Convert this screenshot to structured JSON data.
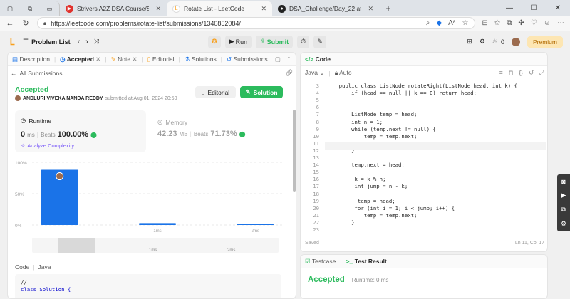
{
  "browser": {
    "tabs": [
      {
        "label": "Strivers A2Z DSA Course/Sheet",
        "fav_color": "#e0322d",
        "active": false
      },
      {
        "label": "Rotate List - LeetCode",
        "fav_color": "#f89f1b",
        "active": true
      },
      {
        "label": "DSA_Challenge/Day_22 at main",
        "fav_color": "#222222",
        "active": false
      }
    ],
    "new_tab": "+",
    "url": "https://leetcode.com/problems/rotate-list/submissions/1340852084/"
  },
  "header": {
    "problem_list": "Problem List",
    "run": "Run",
    "submit": "Submit",
    "streak_count": "0",
    "premium": "Premium"
  },
  "left_tabs": [
    "Description",
    "Accepted",
    "Note",
    "Editorial",
    "Solutions",
    "Submissions"
  ],
  "all_submissions": "All Submissions",
  "result": {
    "status": "Accepted",
    "user": "ANDLURI VIVEKA NANDA REDDY",
    "submitted": "submitted at Aug 01, 2024 20:50",
    "editorial_btn": "Editorial",
    "solution_btn": "Solution"
  },
  "runtime": {
    "label": "Runtime",
    "value": "0",
    "unit": "ms",
    "beats_label": "Beats",
    "beats": "100.00%",
    "analyze": "Analyze Complexity"
  },
  "memory": {
    "label": "Memory",
    "value": "42.23",
    "unit": "MB",
    "beats_label": "Beats",
    "beats": "71.73%"
  },
  "chart_data": {
    "type": "bar",
    "categories": [
      "0ms",
      "1ms",
      "2ms"
    ],
    "x_tick_labels": [
      "1ms",
      "2ms"
    ],
    "values": [
      88,
      3,
      2
    ],
    "ylim": [
      0,
      100
    ],
    "y_ticks": [
      "100%",
      "50%",
      "0%"
    ],
    "highlight_color": "#1a73e8",
    "bar_color": "#1a73e8"
  },
  "mini_axis_labels": [
    "1ms",
    "2ms"
  ],
  "code_section": {
    "label": "Code",
    "lang": "Java",
    "lines": [
      "//",
      "class Solution {"
    ]
  },
  "editor": {
    "title": "Code",
    "lang": "Java",
    "mode": "Auto",
    "saved": "Saved",
    "cursor": "Ln 11, Col 17",
    "lines": [
      {
        "n": "3",
        "t": "    public class ListNode rotateRight(ListNode head, int k) {"
      },
      {
        "n": "4",
        "t": "        if (head == null || k == 0) return head;"
      },
      {
        "n": "5",
        "t": ""
      },
      {
        "n": "6",
        "t": ""
      },
      {
        "n": "7",
        "t": "        ListNode temp = head;"
      },
      {
        "n": "8",
        "t": "        int n = 1;"
      },
      {
        "n": "9",
        "t": "        while (temp.next != null) {"
      },
      {
        "n": "10",
        "t": "            temp = temp.next;"
      },
      {
        "n": "11",
        "t": "            n++;"
      },
      {
        "n": "12",
        "t": "        }"
      },
      {
        "n": "13",
        "t": ""
      },
      {
        "n": "14",
        "t": "        temp.next = head;"
      },
      {
        "n": "15",
        "t": ""
      },
      {
        "n": "16",
        "t": "         k = k % n;"
      },
      {
        "n": "17",
        "t": "         int jump = n - k;"
      },
      {
        "n": "18",
        "t": ""
      },
      {
        "n": "19",
        "t": "          temp = head;"
      },
      {
        "n": "20",
        "t": "         for (int i = 1; i < jump; i++) {"
      },
      {
        "n": "21",
        "t": "            temp = temp.next;"
      },
      {
        "n": "22",
        "t": "        }"
      },
      {
        "n": "23",
        "t": ""
      }
    ]
  },
  "bottom": {
    "testcase": "Testcase",
    "test_result": "Test Result",
    "status": "Accepted",
    "runtime": "Runtime: 0 ms"
  }
}
